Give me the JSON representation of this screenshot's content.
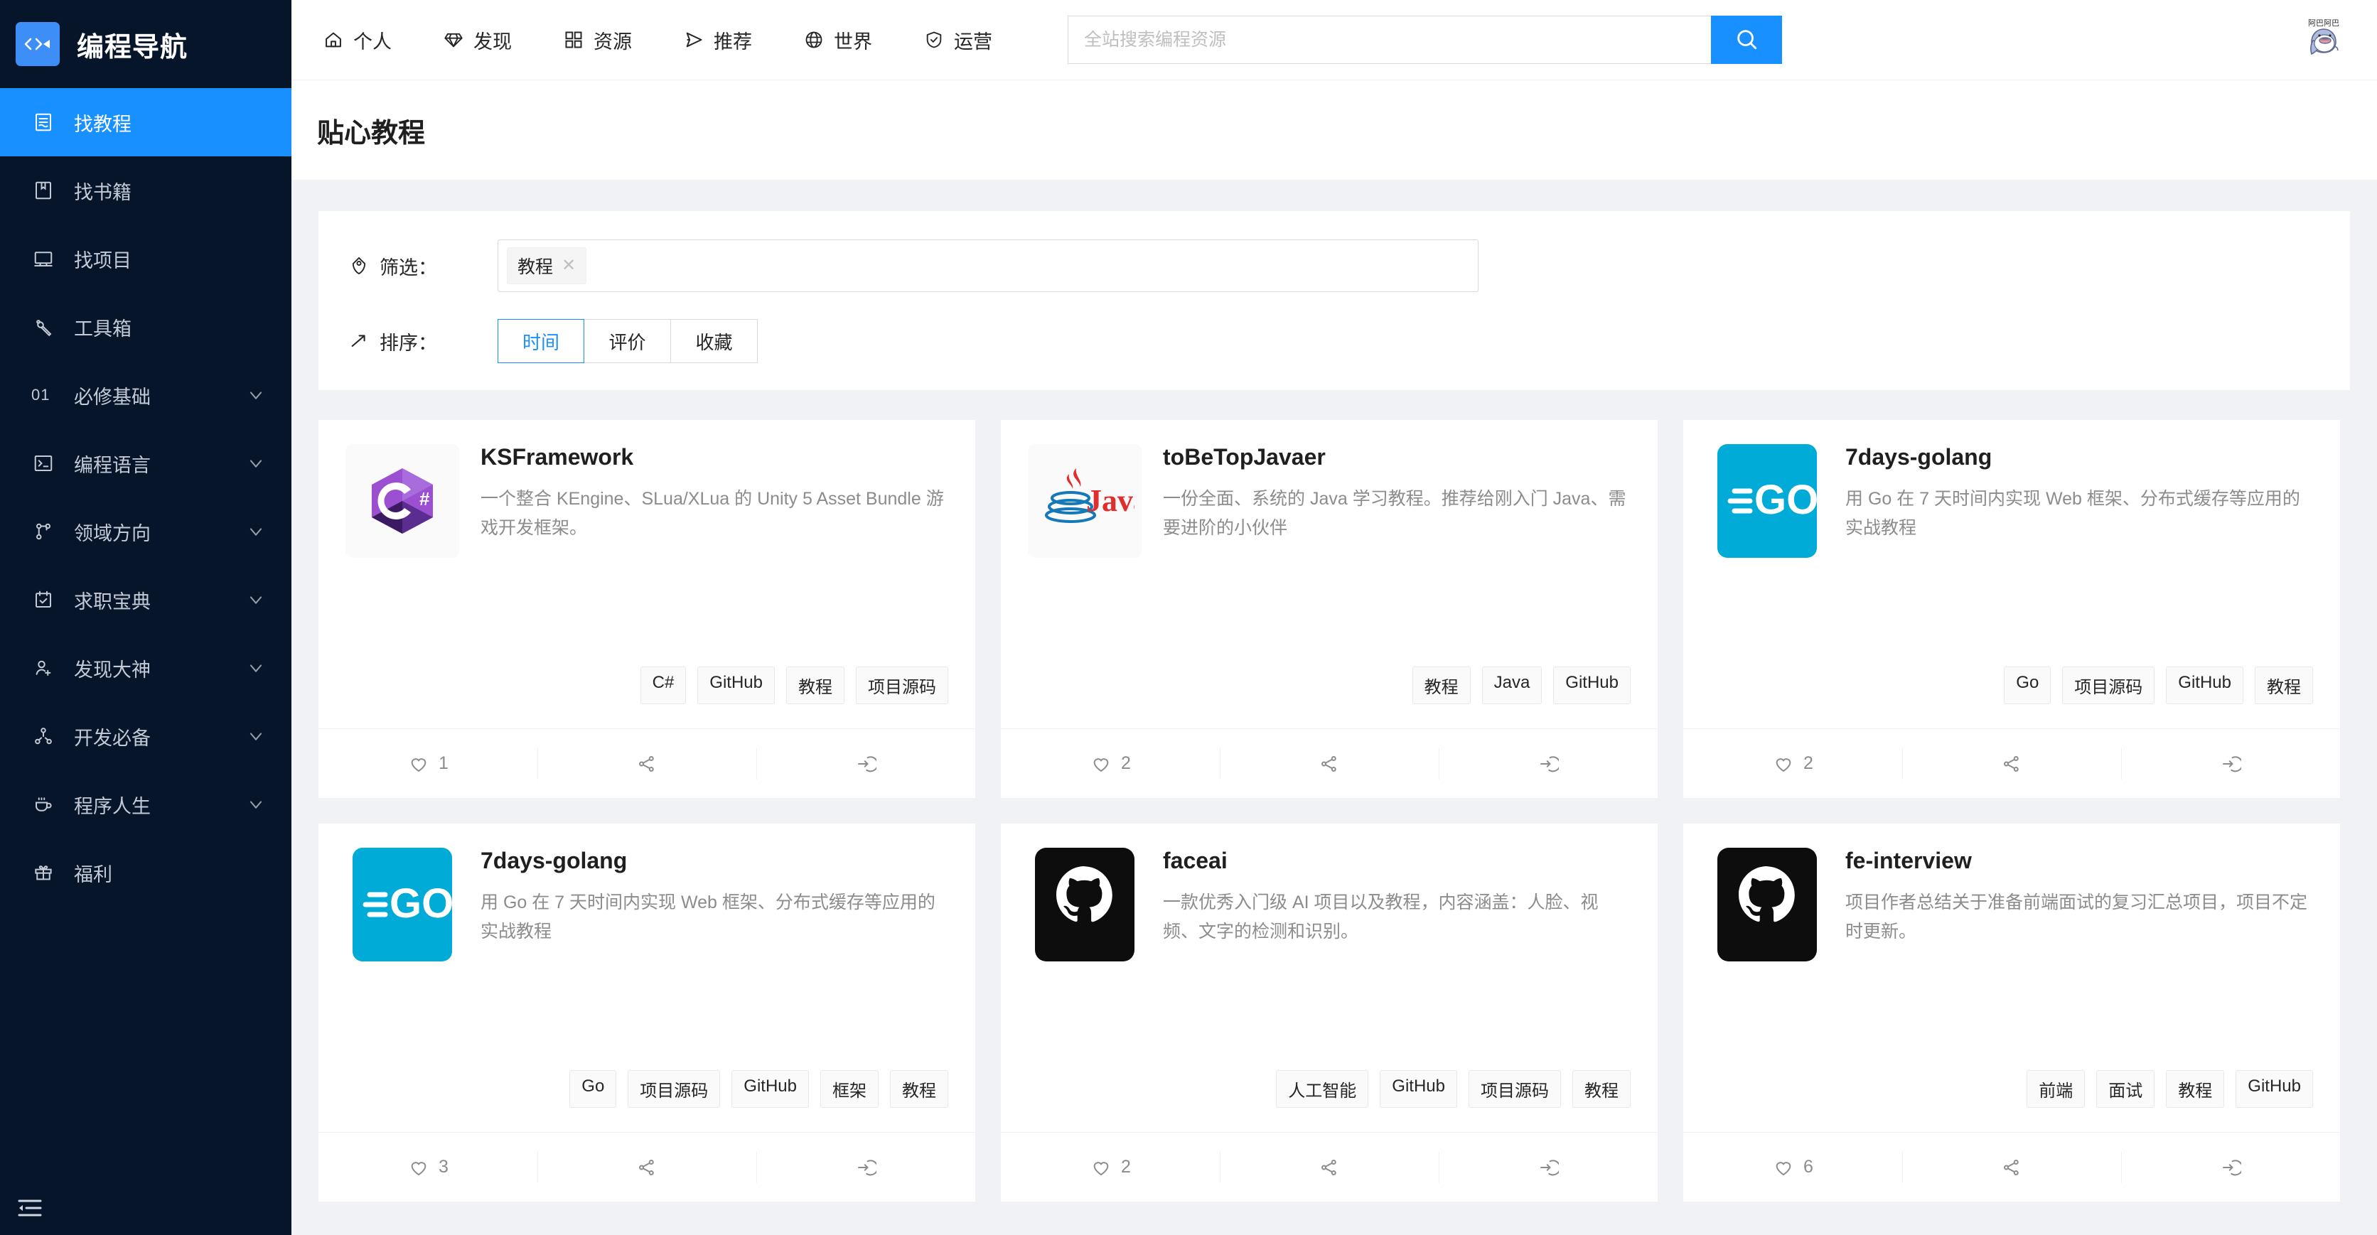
{
  "brand": {
    "name": "编程导航",
    "logo_icon": "code-fish-logo-icon",
    "accent": "#1890ff",
    "sidebar_bg": "#061529"
  },
  "sidebar": {
    "items": [
      {
        "label": "找教程",
        "icon": "tutorial-icon",
        "active": true,
        "expandable": false
      },
      {
        "label": "找书籍",
        "icon": "book-icon",
        "active": false,
        "expandable": false
      },
      {
        "label": "找项目",
        "icon": "project-icon",
        "active": false,
        "expandable": false
      },
      {
        "label": "工具箱",
        "icon": "wrench-icon",
        "active": false,
        "expandable": false
      },
      {
        "label": "必修基础",
        "icon": "number-01",
        "prefix": "01",
        "active": false,
        "expandable": true
      },
      {
        "label": "编程语言",
        "icon": "terminal-icon",
        "active": false,
        "expandable": true
      },
      {
        "label": "领域方向",
        "icon": "branch-icon",
        "active": false,
        "expandable": true
      },
      {
        "label": "求职宝典",
        "icon": "calendar-check-icon",
        "active": false,
        "expandable": true
      },
      {
        "label": "发现大神",
        "icon": "user-add-icon",
        "active": false,
        "expandable": true
      },
      {
        "label": "开发必备",
        "icon": "share-nodes-icon",
        "active": false,
        "expandable": true
      },
      {
        "label": "程序人生",
        "icon": "coffee-icon",
        "active": false,
        "expandable": true
      },
      {
        "label": "福利",
        "icon": "gift-icon",
        "active": false,
        "expandable": false
      }
    ],
    "collapse_icon": "menu-fold-icon"
  },
  "topnav": {
    "items": [
      {
        "label": "个人",
        "icon": "home-icon"
      },
      {
        "label": "发现",
        "icon": "diamond-icon"
      },
      {
        "label": "资源",
        "icon": "appstore-icon"
      },
      {
        "label": "推荐",
        "icon": "send-icon"
      },
      {
        "label": "世界",
        "icon": "globe-icon"
      },
      {
        "label": "运营",
        "icon": "shield-check-icon"
      }
    ]
  },
  "search": {
    "placeholder": "全站搜索编程资源",
    "value": "",
    "button_icon": "search-icon"
  },
  "avatar": {
    "icon": "whale-avatar-icon",
    "caption": "阿巴阿巴"
  },
  "page": {
    "title": "贴心教程"
  },
  "filters": {
    "filter_label": "筛选：",
    "filter_icon": "tag-icon",
    "chips": [
      {
        "label": "教程",
        "remove_icon": "close-icon"
      }
    ],
    "sort_label": "排序：",
    "sort_icon": "trending-up-icon",
    "sort_options": [
      {
        "label": "时间",
        "active": true
      },
      {
        "label": "评价",
        "active": false
      },
      {
        "label": "收藏",
        "active": false
      }
    ]
  },
  "cards": [
    {
      "title": "KSFramework",
      "desc": "一个整合 KEngine、SLua/XLua 的 Unity 5 Asset Bundle 游戏开发框架。",
      "logo": "csharp",
      "tags": [
        "C#",
        "GitHub",
        "教程",
        "项目源码"
      ],
      "likes": "1",
      "footer_icons": [
        "heart-icon",
        "share-alt-icon",
        "enter-icon"
      ]
    },
    {
      "title": "toBeTopJavaer",
      "desc": "一份全面、系统的 Java 学习教程。推荐给刚入门 Java、需要进阶的小伙伴",
      "logo": "java",
      "tags": [
        "教程",
        "Java",
        "GitHub"
      ],
      "likes": "2",
      "footer_icons": [
        "heart-icon",
        "share-alt-icon",
        "enter-icon"
      ]
    },
    {
      "title": "7days-golang",
      "desc": "用 Go 在 7 天时间内实现 Web 框架、分布式缓存等应用的实战教程",
      "logo": "go",
      "tags": [
        "Go",
        "项目源码",
        "GitHub",
        "教程"
      ],
      "likes": "2",
      "footer_icons": [
        "heart-icon",
        "share-alt-icon",
        "enter-icon"
      ]
    },
    {
      "title": "7days-golang",
      "desc": "用 Go 在 7 天时间内实现 Web 框架、分布式缓存等应用的实战教程",
      "logo": "go",
      "tags": [
        "Go",
        "项目源码",
        "GitHub",
        "框架",
        "教程"
      ],
      "likes": "3",
      "footer_icons": [
        "heart-icon",
        "share-alt-icon",
        "enter-icon"
      ]
    },
    {
      "title": "faceai",
      "desc": "一款优秀入门级 AI 项目以及教程，内容涵盖：人脸、视频、文字的检测和识别。",
      "logo": "github",
      "tags": [
        "人工智能",
        "GitHub",
        "项目源码",
        "教程"
      ],
      "likes": "2",
      "footer_icons": [
        "heart-icon",
        "share-alt-icon",
        "enter-icon"
      ]
    },
    {
      "title": "fe-interview",
      "desc": "项目作者总结关于准备前端面试的复习汇总项目，项目不定时更新。",
      "logo": "github",
      "tags": [
        "前端",
        "面试",
        "教程",
        "GitHub"
      ],
      "likes": "6",
      "footer_icons": [
        "heart-icon",
        "share-alt-icon",
        "enter-icon"
      ]
    }
  ]
}
